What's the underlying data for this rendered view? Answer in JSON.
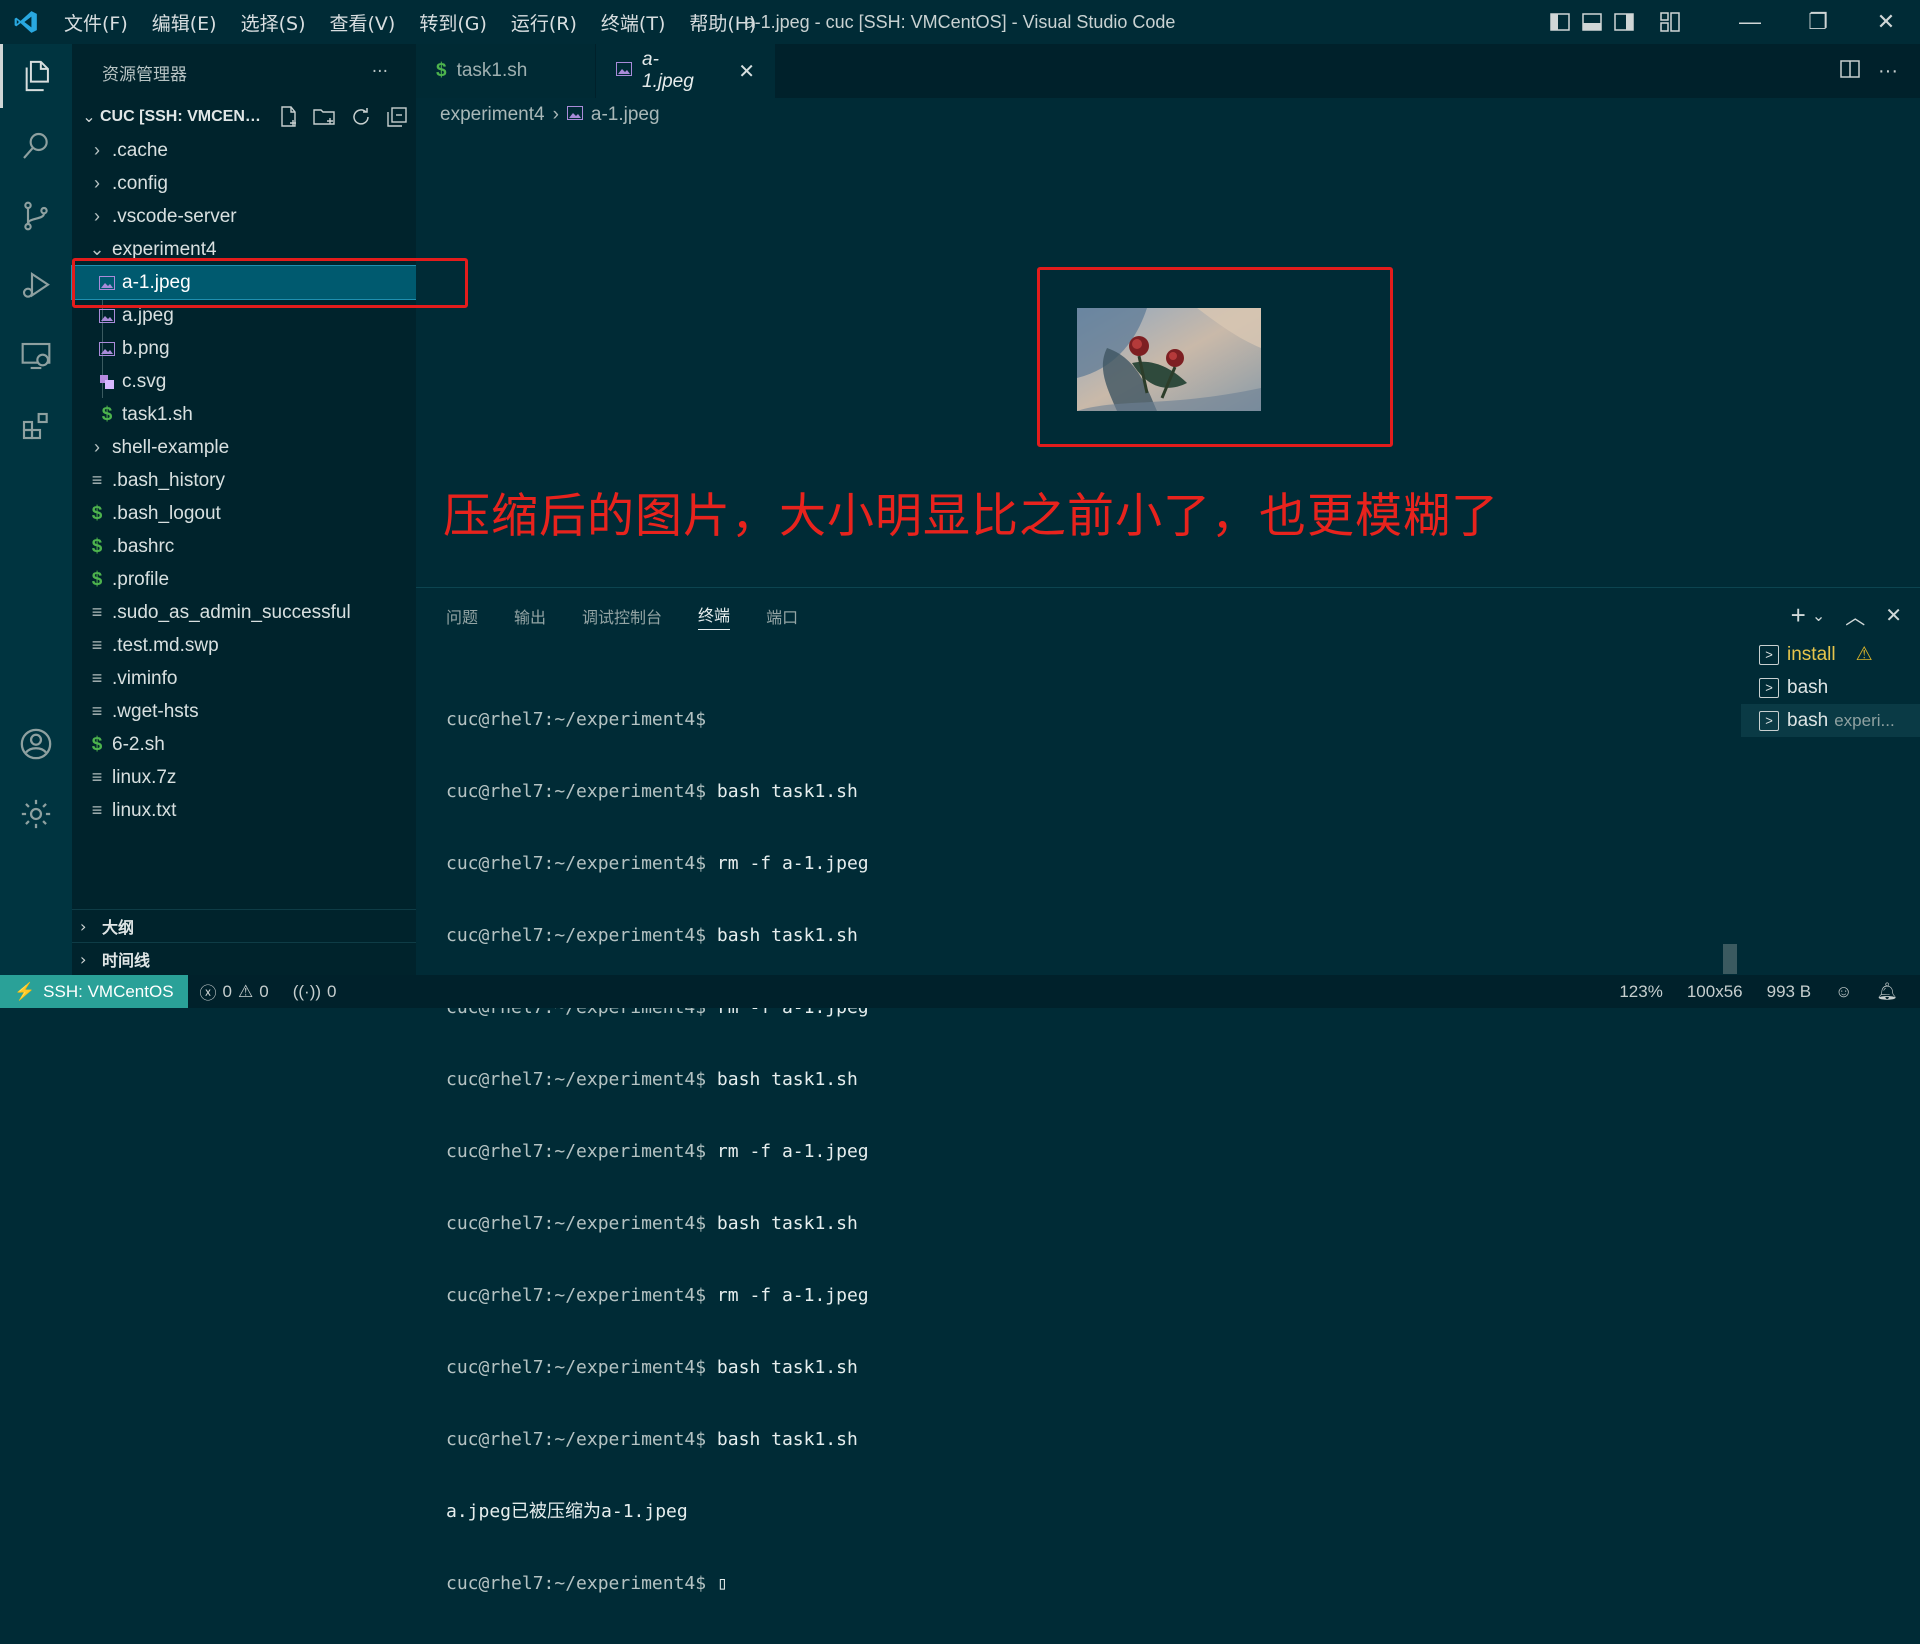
{
  "window": {
    "title": "a-1.jpeg - cuc [SSH: VMCentOS] - Visual Studio Code",
    "menu": [
      "文件(F)",
      "编辑(E)",
      "选择(S)",
      "查看(V)",
      "转到(G)",
      "运行(R)",
      "终端(T)",
      "帮助(H)"
    ],
    "controls": {
      "minimize": "—",
      "restore": "❐",
      "close": "✕"
    }
  },
  "sidebar": {
    "title": "资源管理器",
    "more": "···",
    "section_title": "CUC [SSH: VMCENTOS]",
    "tree": [
      {
        "label": ".cache",
        "type": "folder",
        "depth": 0,
        "expanded": false
      },
      {
        "label": ".config",
        "type": "folder",
        "depth": 0,
        "expanded": false
      },
      {
        "label": ".vscode-server",
        "type": "folder",
        "depth": 0,
        "expanded": false
      },
      {
        "label": "experiment4",
        "type": "folder",
        "depth": 0,
        "expanded": true
      },
      {
        "label": "a-1.jpeg",
        "type": "image",
        "depth": 1,
        "selected": true
      },
      {
        "label": "a.jpeg",
        "type": "image",
        "depth": 1
      },
      {
        "label": "b.png",
        "type": "image",
        "depth": 1
      },
      {
        "label": "c.svg",
        "type": "svg",
        "depth": 1
      },
      {
        "label": "task1.sh",
        "type": "shell",
        "depth": 1
      },
      {
        "label": "shell-example",
        "type": "folder",
        "depth": 0,
        "expanded": false
      },
      {
        "label": ".bash_history",
        "type": "text",
        "depth": 0
      },
      {
        "label": ".bash_logout",
        "type": "shell",
        "depth": 0
      },
      {
        "label": ".bashrc",
        "type": "shell",
        "depth": 0
      },
      {
        "label": ".profile",
        "type": "shell",
        "depth": 0
      },
      {
        "label": ".sudo_as_admin_successful",
        "type": "text",
        "depth": 0
      },
      {
        "label": ".test.md.swp",
        "type": "text",
        "depth": 0
      },
      {
        "label": ".viminfo",
        "type": "text",
        "depth": 0
      },
      {
        "label": ".wget-hsts",
        "type": "text",
        "depth": 0
      },
      {
        "label": "6-2.sh",
        "type": "shell",
        "depth": 0
      },
      {
        "label": "linux.7z",
        "type": "text",
        "depth": 0
      },
      {
        "label": "linux.txt",
        "type": "text",
        "depth": 0
      }
    ],
    "outline_label": "大纲",
    "timeline_label": "时间线"
  },
  "editor": {
    "tabs": [
      {
        "label": "task1.sh",
        "icon": "$",
        "active": false
      },
      {
        "label": "a-1.jpeg",
        "icon": "image-icon",
        "active": true
      }
    ],
    "breadcrumbs": [
      "experiment4",
      "a-1.jpeg"
    ],
    "annotation": "压缩后的图片，大小明显比之前小了，也更模糊了"
  },
  "panel": {
    "tabs": [
      "问题",
      "输出",
      "调试控制台",
      "终端",
      "端口"
    ],
    "active_tab": "终端",
    "terminal_lines": [
      {
        "prompt": "cuc@rhel7:~/experiment4$",
        "cmd": ""
      },
      {
        "prompt": "cuc@rhel7:~/experiment4$",
        "cmd": " bash task1.sh"
      },
      {
        "prompt": "cuc@rhel7:~/experiment4$",
        "cmd": " rm -f a-1.jpeg"
      },
      {
        "prompt": "cuc@rhel7:~/experiment4$",
        "cmd": " bash task1.sh"
      },
      {
        "prompt": "cuc@rhel7:~/experiment4$",
        "cmd": " rm -f a-1.jpeg"
      },
      {
        "prompt": "cuc@rhel7:~/experiment4$",
        "cmd": " bash task1.sh"
      },
      {
        "prompt": "cuc@rhel7:~/experiment4$",
        "cmd": " rm -f a-1.jpeg"
      },
      {
        "prompt": "cuc@rhel7:~/experiment4$",
        "cmd": " bash task1.sh"
      },
      {
        "prompt": "cuc@rhel7:~/experiment4$",
        "cmd": " rm -f a-1.jpeg"
      },
      {
        "prompt": "cuc@rhel7:~/experiment4$",
        "cmd": " bash task1.sh"
      },
      {
        "prompt": "cuc@rhel7:~/experiment4$",
        "cmd": " bash task1.sh"
      },
      {
        "prompt": "",
        "cmd": "a.jpeg已被压缩为a-1.jpeg"
      },
      {
        "prompt": "cuc@rhel7:~/experiment4$",
        "cmd": " ▯"
      }
    ],
    "terminal_list": [
      {
        "label": "install",
        "detail": "",
        "warn": true
      },
      {
        "label": "bash",
        "detail": ""
      },
      {
        "label": "bash",
        "detail": "experi...",
        "selected": true
      }
    ]
  },
  "statusbar": {
    "remote": "SSH: VMCentOS",
    "errors": "0",
    "warnings": "0",
    "ports": "0",
    "zoom": "123%",
    "dimensions": "100x56",
    "size": "993 B"
  },
  "colors": {
    "background": "#002b36",
    "sidebar": "#00232c",
    "accent": "#2aa198",
    "annotation_red": "#e31c1c"
  }
}
